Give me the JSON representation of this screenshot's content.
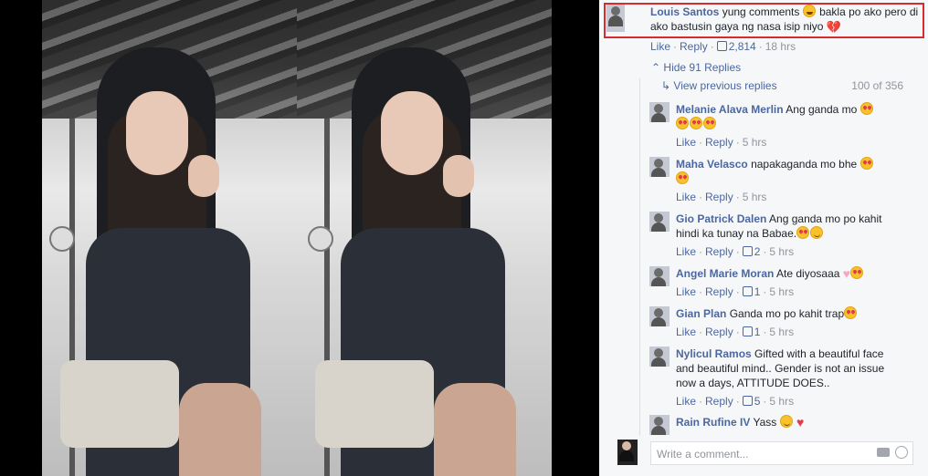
{
  "top_comment": {
    "author": "Louis Santos",
    "text_part1": "yung comments",
    "text_part2": "bakla po ako pero di ako bastusin gaya ng nasa isip niyo",
    "like": "Like",
    "reply": "Reply",
    "likes": "2,814",
    "time": "18 hrs"
  },
  "hide_replies": "Hide 91 Replies",
  "view_previous": "View previous replies",
  "reply_count": "100 of 356",
  "replies": [
    {
      "author": "Melanie Alava Merlin",
      "text": "Ang ganda mo",
      "likes": "",
      "time": "5 hrs"
    },
    {
      "author": "Maha Velasco",
      "text": "napakaganda mo bhe",
      "likes": "",
      "time": "5 hrs"
    },
    {
      "author": "Gio Patrick Dalen",
      "text": "Ang ganda mo po kahit hindi ka tunay na Babae.",
      "likes": "2",
      "time": "5 hrs"
    },
    {
      "author": "Angel Marie Moran",
      "text": "Ate diyosaaa",
      "likes": "1",
      "time": "5 hrs"
    },
    {
      "author": "Gian Plan",
      "text": "Ganda mo po kahit trap",
      "likes": "1",
      "time": "5 hrs"
    },
    {
      "author": "Nylicul Ramos",
      "text": "Gifted with a beautiful face and beautiful mind.. Gender is not an issue now a days, ATTITUDE DOES..",
      "likes": "5",
      "time": "5 hrs"
    },
    {
      "author": "Rain Rufine IV",
      "text": "Yass",
      "likes": "",
      "time": ""
    }
  ],
  "actions": {
    "like": "Like",
    "reply": "Reply",
    "sep": "·"
  },
  "composer": {
    "placeholder": "Write a comment..."
  },
  "colors": {
    "link": "#365899",
    "highlight": "#d92b2b",
    "panel_bg": "#f6f7f9"
  }
}
